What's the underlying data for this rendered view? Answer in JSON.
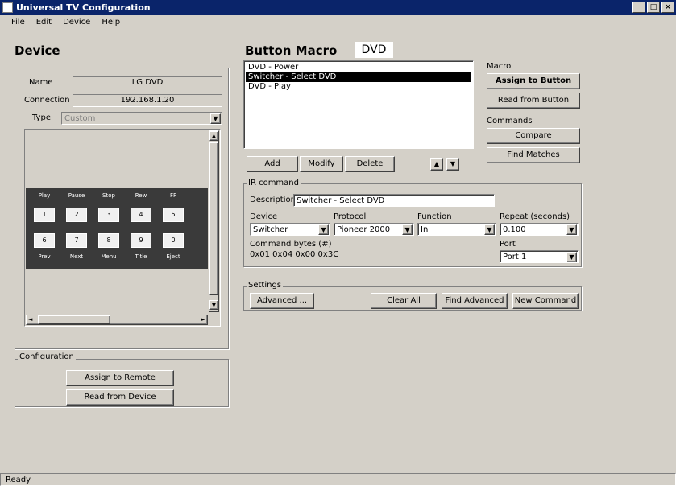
{
  "window": {
    "title": "Universal TV Configuration",
    "min": "_",
    "max": "□",
    "close": "×"
  },
  "menu": [
    "File",
    "Edit",
    "Device",
    "Help"
  ],
  "device": {
    "heading": "Device",
    "name_label": "Name",
    "name_value": "LG DVD",
    "connection_label": "Connection",
    "connection_value": "192.168.1.20",
    "type_label": "Type",
    "type_value": "Custom",
    "remote_keys_row1": [
      "1",
      "2",
      "3",
      "4",
      "5"
    ],
    "remote_labels_row1": [
      "Play",
      "Pause",
      "Stop",
      "Rew",
      "FF"
    ],
    "remote_keys_row2": [
      "6",
      "7",
      "8",
      "9",
      "0"
    ],
    "remote_labels_row2": [
      "Prev",
      "Next",
      "Menu",
      "Title",
      "Eject"
    ]
  },
  "configuration": {
    "title": "Configuration",
    "assign_label": "Assign to Remote",
    "read_label": "Read from Device"
  },
  "macro": {
    "heading": "Button Macro",
    "device_name": "DVD",
    "items": [
      "DVD - Power",
      "Switcher - Select DVD",
      "DVD - Play"
    ],
    "selected_index": 1,
    "add_label": "Add",
    "modify_label": "Modify",
    "delete_label": "Delete",
    "up_label": "▲",
    "down_label": "▼"
  },
  "macro_side": {
    "macro_group": "Macro",
    "assign_label": "Assign to Button",
    "read_label": "Read from Button",
    "commands_group": "Commands",
    "compare_label": "Compare",
    "find_label": "Find Matches"
  },
  "ir_command": {
    "group_title": "IR command",
    "description_label": "Description",
    "description_value": "Switcher - Select DVD",
    "device_label": "Device",
    "device_value": "Switcher",
    "protocol_label": "Protocol",
    "protocol_value": "Pioneer 2000",
    "function_label": "Function",
    "function_value": "In",
    "repeat_label": "Repeat (seconds)",
    "repeat_value": "0.100",
    "command_bytes_label": "Command bytes (#)",
    "command_bytes_value": "0x01 0x04 0x00 0x3C",
    "port_label": "Port",
    "port_value": "Port 1"
  },
  "settings": {
    "title": "Settings",
    "advanced_label": "Advanced ...",
    "clear_label": "Clear All",
    "find_adv_label": "Find Advanced",
    "new_cmd_label": "New Command"
  },
  "status": {
    "text": "Ready"
  }
}
